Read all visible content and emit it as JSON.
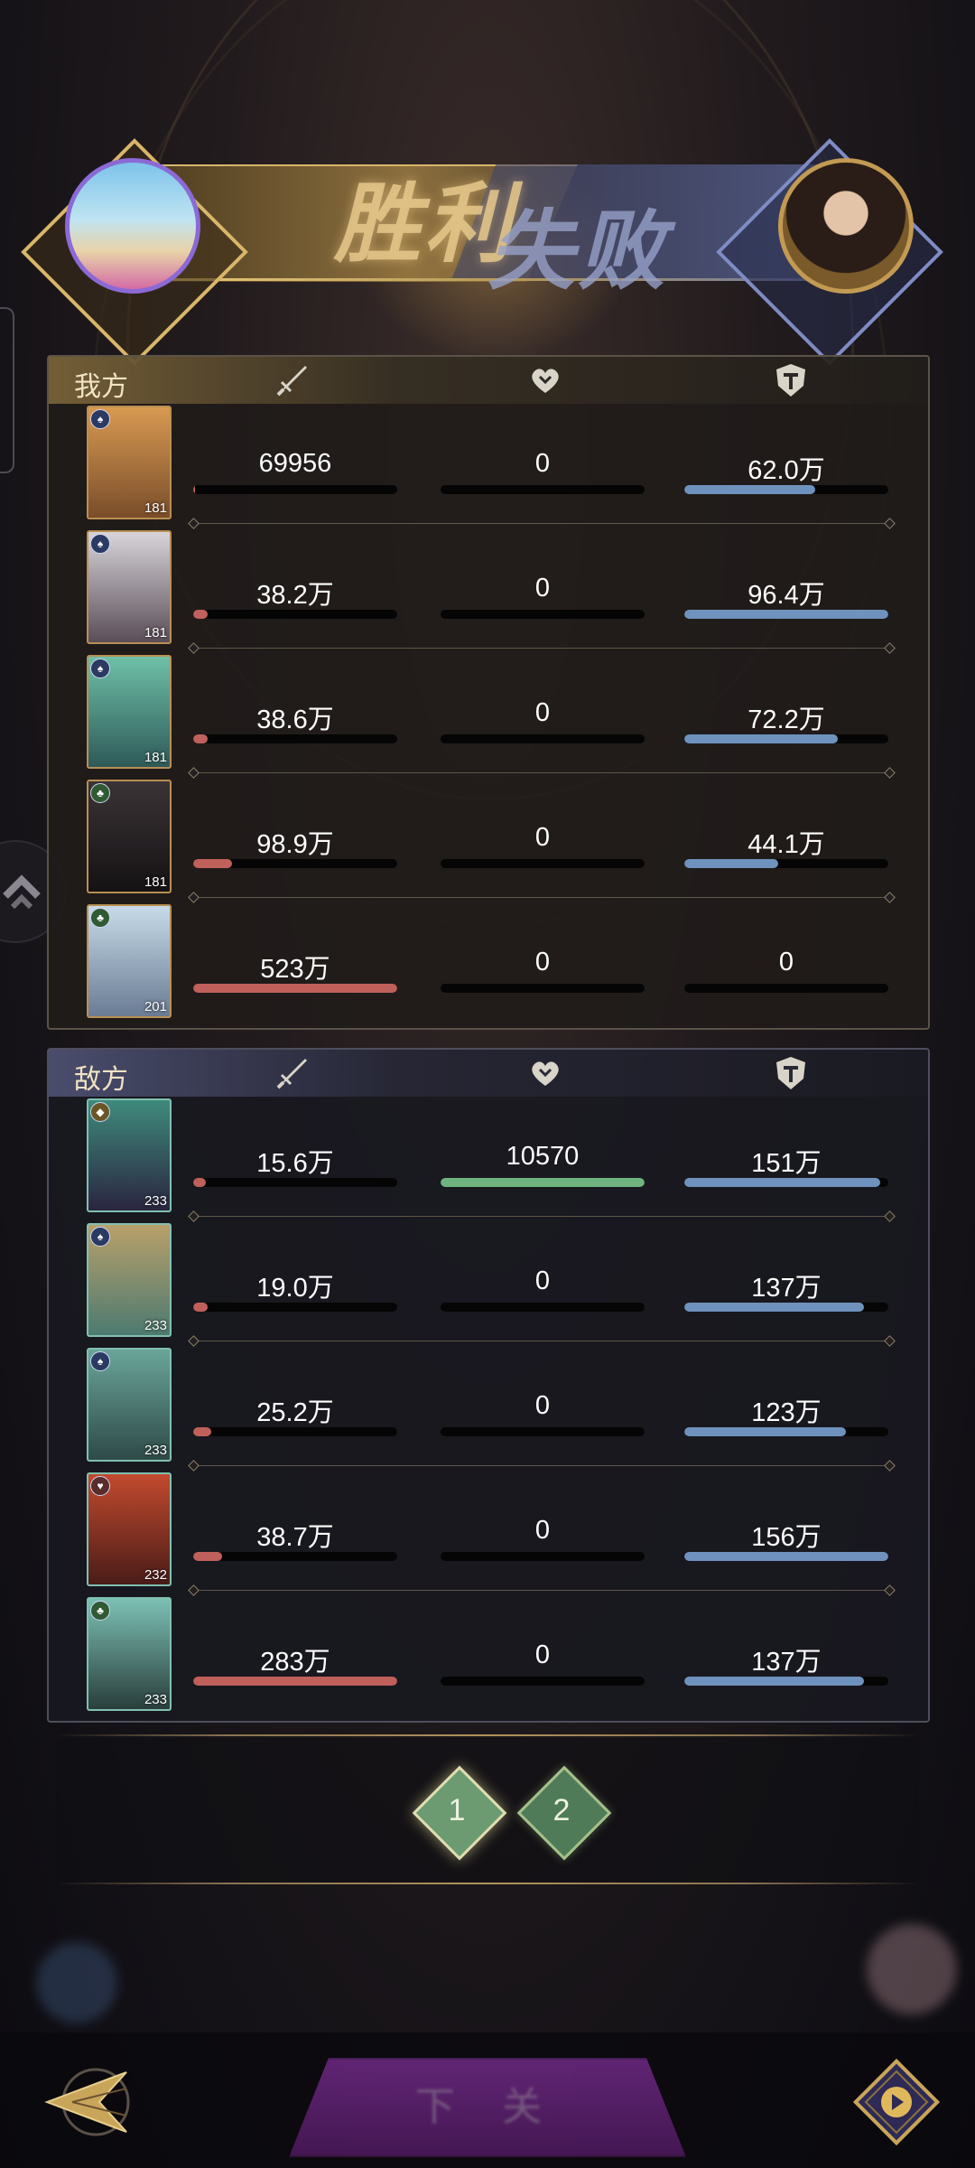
{
  "banner": {
    "win_text": "胜利",
    "lose_text": "失败"
  },
  "ally": {
    "label": "我方",
    "rows": [
      {
        "level": "181",
        "damage": "69956",
        "damage_pct": 1,
        "heal": "0",
        "heal_pct": 0,
        "tank": "62.0万",
        "tank_pct": 64,
        "portrait_color": "#c98a45"
      },
      {
        "level": "181",
        "damage": "38.2万",
        "damage_pct": 7,
        "heal": "0",
        "heal_pct": 0,
        "tank": "96.4万",
        "tank_pct": 100,
        "portrait_color": "#b6b0b8"
      },
      {
        "level": "181",
        "damage": "38.6万",
        "damage_pct": 7,
        "heal": "0",
        "heal_pct": 0,
        "tank": "72.2万",
        "tank_pct": 75,
        "portrait_color": "#4f9a87"
      },
      {
        "level": "181",
        "damage": "98.9万",
        "damage_pct": 19,
        "heal": "0",
        "heal_pct": 0,
        "tank": "44.1万",
        "tank_pct": 46,
        "portrait_color": "#2a2528"
      },
      {
        "level": "201",
        "damage": "523万",
        "damage_pct": 100,
        "heal": "0",
        "heal_pct": 0,
        "tank": "0",
        "tank_pct": 0,
        "portrait_color": "#a9c4d8"
      }
    ]
  },
  "enemy": {
    "label": "敌方",
    "rows": [
      {
        "level": "233",
        "damage": "15.6万",
        "damage_pct": 6,
        "heal": "10570",
        "heal_pct": 100,
        "tank": "151万",
        "tank_pct": 96,
        "portrait_color": "#3f8a7c"
      },
      {
        "level": "233",
        "damage": "19.0万",
        "damage_pct": 7,
        "heal": "0",
        "heal_pct": 0,
        "tank": "137万",
        "tank_pct": 88,
        "portrait_color": "#6fa08a"
      },
      {
        "level": "233",
        "damage": "25.2万",
        "damage_pct": 9,
        "heal": "0",
        "heal_pct": 0,
        "tank": "123万",
        "tank_pct": 79,
        "portrait_color": "#5b8e85"
      },
      {
        "level": "232",
        "damage": "38.7万",
        "damage_pct": 14,
        "heal": "0",
        "heal_pct": 0,
        "tank": "156万",
        "tank_pct": 100,
        "portrait_color": "#9a3d2a"
      },
      {
        "level": "233",
        "damage": "283万",
        "damage_pct": 100,
        "heal": "0",
        "heal_pct": 0,
        "tank": "137万",
        "tank_pct": 88,
        "portrait_color": "#5a9a8f"
      }
    ]
  },
  "pager": {
    "pages": [
      "1",
      "2"
    ],
    "active": "1"
  },
  "bottom": {
    "continue_label": "下 关"
  },
  "icons": {
    "damage": "sword-icon",
    "heal": "heart-icon",
    "tank": "shield-icon",
    "back": "back-arrow-icon",
    "replay": "replay-icon"
  }
}
